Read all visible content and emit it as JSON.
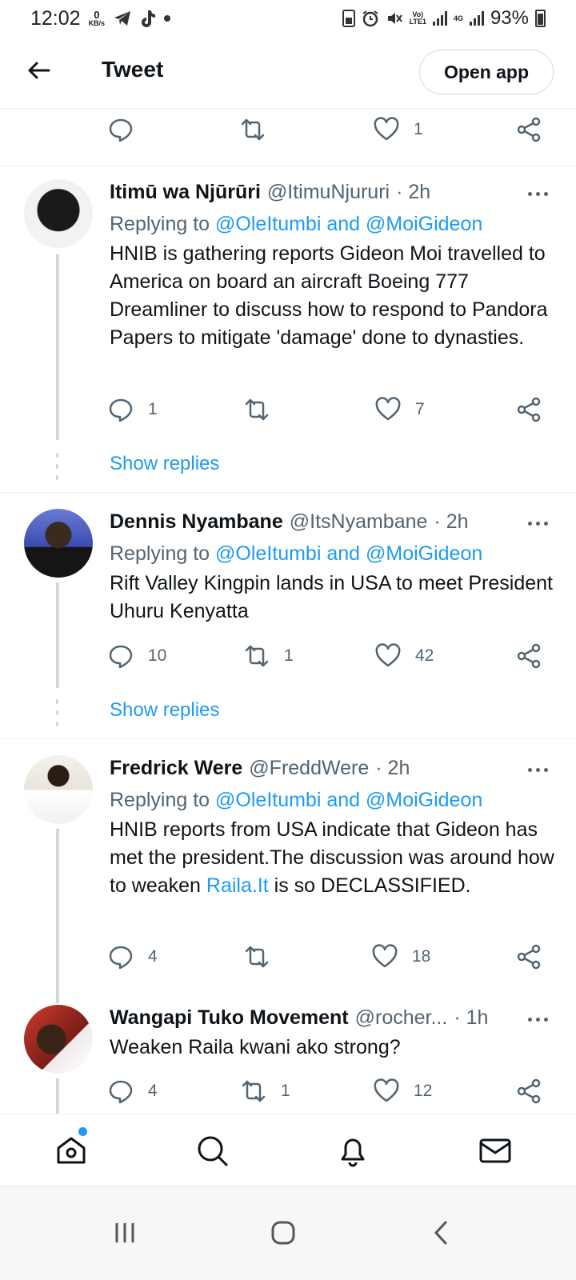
{
  "status_bar": {
    "time": "12:02",
    "kbs_value": "0",
    "kbs_unit": "KB/s",
    "volte": "Vo)",
    "lte": "LTE1",
    "net": "4G",
    "battery": "93%"
  },
  "header": {
    "title": "Tweet",
    "open_app_label": "Open app"
  },
  "top_actions": {
    "reply_count": "",
    "retweet_count": "",
    "like_count": "1"
  },
  "tweets": [
    {
      "name": "Itimū wa Njūrūri",
      "handle": "@ItimuNjururi",
      "time": "· 2h",
      "replying_prefix": "Replying to",
      "replying_to": "@OleItumbi and @MoiGideon",
      "body": "HNIB is gathering reports Gideon Moi travelled to America on board an aircraft Boeing 777 Dreamliner to discuss how to respond to Pandora Papers to mitigate 'damage' done to dynasties.",
      "reply_count": "1",
      "retweet_count": "",
      "like_count": "7",
      "show_replies": "Show replies"
    },
    {
      "name": "Dennis Nyambane",
      "handle": "@ItsNyambane",
      "time": "· 2h",
      "replying_prefix": "Replying to",
      "replying_to": "@OleItumbi and @MoiGideon",
      "body": "Rift Valley Kingpin lands in USA to meet President Uhuru Kenyatta",
      "reply_count": "10",
      "retweet_count": "1",
      "like_count": "42",
      "show_replies": "Show replies"
    },
    {
      "name": "Fredrick Were",
      "handle": "@FreddWere",
      "time": "· 2h",
      "replying_prefix": "Replying to",
      "replying_to": "@OleItumbi and @MoiGideon",
      "body_part1": "HNIB reports from USA indicate that Gideon has met the president.The discussion was around how to weaken ",
      "body_link": "Raila.It",
      "body_part2": " is so DECLASSIFIED.",
      "reply_count": "4",
      "retweet_count": "",
      "like_count": "18"
    },
    {
      "name": "Wangapi Tuko Movement",
      "handle": "@rocher...",
      "time": "· 1h",
      "body": "Weaken Raila kwani ako strong?",
      "reply_count": "4",
      "retweet_count": "1",
      "like_count": "12"
    }
  ],
  "colors": {
    "accent": "#1d9bf0",
    "text": "#0f1419",
    "muted": "#536471",
    "border": "#eff3f4"
  }
}
